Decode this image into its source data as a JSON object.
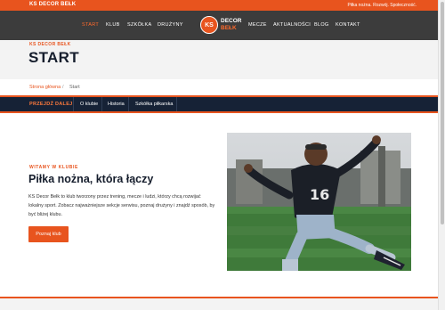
{
  "topbar": {
    "brand": "KS DECOR BEŁK",
    "tagline": "Piłka nożna. Rozwój. Społeczność."
  },
  "nav": {
    "left": [
      "START",
      "KLUB",
      "SZKÓŁKA",
      "DRUŻYNY"
    ],
    "right": [
      "MECZE",
      "AKTUALNOŚCI",
      "BLOG",
      "KONTAKT"
    ],
    "active": "START"
  },
  "logo": {
    "badge": "KS",
    "line1": "DECOR",
    "line2": "BEŁK"
  },
  "hero": {
    "kicker": "KS DECOR BEŁK",
    "title": "START"
  },
  "breadcrumb": {
    "home": "Strona główna",
    "separator": "/",
    "current": "Start"
  },
  "subnav": {
    "lead": "PRZEJDŹ DALEJ",
    "links": [
      "O klubie",
      "Historia",
      "Szkółka piłkarska"
    ]
  },
  "intro": {
    "kicker": "WITAMY W KLUBIE",
    "headline": "Piłka nożna, która łączy",
    "description": "KS Decor Bełk to klub tworzony przez trening, mecze i ludzi, którzy chcą rozwijać lokalny sport. Zobacz najważniejsze sekcje serwisu, poznaj drużyny i znajdź sposób, by być bliżej klubu.",
    "cta": "Poznaj klub"
  },
  "photo": {
    "jersey_number": "16"
  },
  "colors": {
    "accent": "#e8541e",
    "navy": "#162236",
    "dark": "#3c3c3c"
  }
}
